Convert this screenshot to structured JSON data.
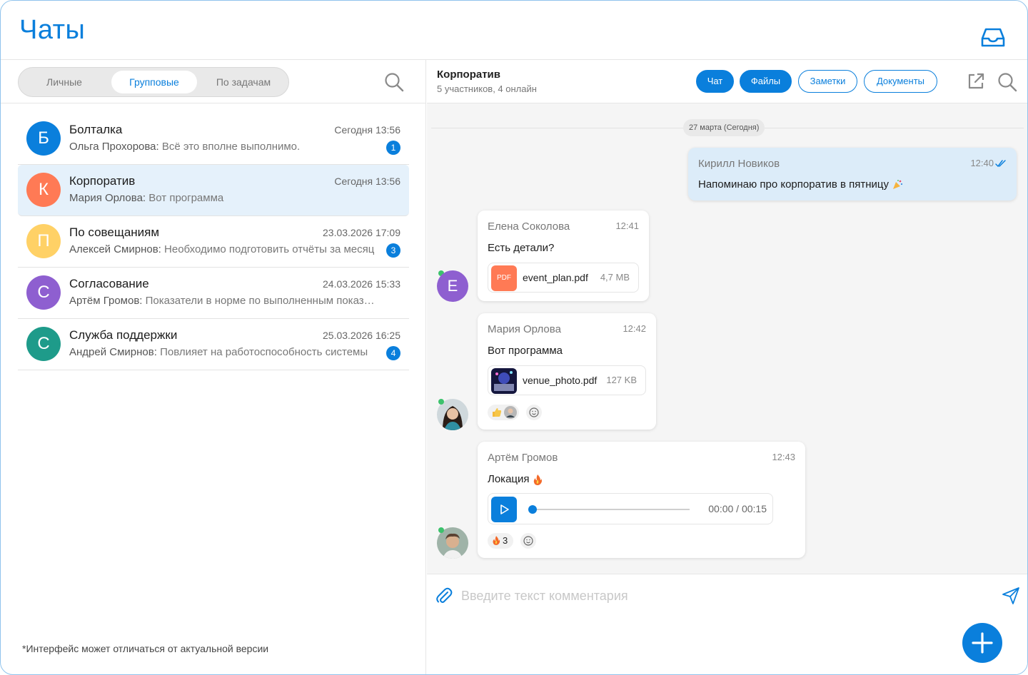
{
  "app": {
    "title": "Чаты"
  },
  "tabs": [
    {
      "label": "Личные"
    },
    {
      "label": "Групповые"
    },
    {
      "label": "По задачам"
    }
  ],
  "chats": [
    {
      "initial": "Б",
      "color": "#0a7fdc",
      "name": "Болталка",
      "time": "Сегодня 13:56",
      "author": "Ольга Прохорова:",
      "text": " Всё это вполне выполнимо.",
      "badge": "1"
    },
    {
      "initial": "К",
      "color": "#ff7a55",
      "name": "Корпоратив",
      "time": "Сегодня 13:56",
      "author": "Мария Орлова:",
      "text": " Вот программа",
      "badge": ""
    },
    {
      "initial": "П",
      "color": "#ffd166",
      "name": "По совещаниям",
      "time": "23.03.2026 17:09",
      "author": "Алексей Смирнов:",
      "text": " Необходимо подготовить отчёты за месяц",
      "badge": "3"
    },
    {
      "initial": "С",
      "color": "#8e5fd0",
      "name": "Согласование",
      "time": "24.03.2026 15:33",
      "author": "Артём Громов:",
      "text": " Показатели в норме по выполненным показателям",
      "badge": ""
    },
    {
      "initial": "С",
      "color": "#1e9b8a",
      "name": " Служба поддержки",
      "time": "25.03.2026 16:25",
      "author": "Андрей Смирнов:",
      "text": " Повлияет на работоспособность системы",
      "badge": "4"
    }
  ],
  "disclaimer": "*Интерфейс может отличаться от актуальной версии",
  "chat": {
    "title": "Корпоратив",
    "subtitle": "5 участников, 4 онлайн",
    "tabs": [
      {
        "label": "Чат"
      },
      {
        "label": "Файлы"
      },
      {
        "label": "Заметки"
      },
      {
        "label": "Документы"
      }
    ]
  },
  "date_chip": "27 марта (Сегодня)",
  "messages": {
    "m1": {
      "author": "Кирилл Новиков",
      "time": "12:40",
      "text": "Напоминаю про корпоратив в пятницу"
    },
    "m2": {
      "author": "Елена Соколова",
      "time": "12:41",
      "text": "Есть детали?",
      "avatar_initial": "Е",
      "file": {
        "type_label": "PDF",
        "name": "event_plan.pdf",
        "size": "4,7 MB"
      }
    },
    "m3": {
      "author": "Мария Орлова",
      "time": "12:42",
      "text": "Вот программа",
      "file": {
        "name": "venue_photo.pdf",
        "size": "127 KB"
      }
    },
    "m4": {
      "author": "Артём Громов",
      "time": "12:43",
      "text": "Локация",
      "voice_time": "00:00 / 00:15",
      "reaction_count": "3"
    }
  },
  "composer": {
    "placeholder": "Введите текст комментария"
  },
  "colors": {
    "accent": "#0a7fdc",
    "online": "#3cc26c",
    "selected_row": "#e5f1fb",
    "own_bubble": "#dcecf9"
  }
}
